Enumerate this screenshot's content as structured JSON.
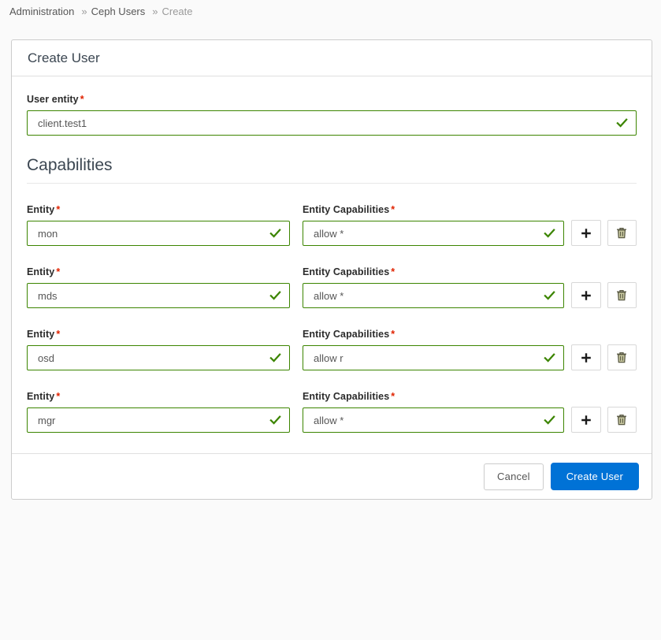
{
  "breadcrumb": {
    "items": [
      {
        "label": "Administration",
        "current": false
      },
      {
        "label": "Ceph Users",
        "current": false
      },
      {
        "label": "Create",
        "current": true
      }
    ],
    "separator": "»"
  },
  "card": {
    "title": "Create User"
  },
  "user_entity": {
    "label": "User entity",
    "required_marker": "*",
    "value": "client.test1",
    "placeholder": "",
    "valid": true
  },
  "capabilities": {
    "heading": "Capabilities",
    "entity_label": "Entity",
    "entity_caps_label": "Entity Capabilities",
    "required_marker": "*",
    "add_button_name": "add",
    "delete_button_name": "delete",
    "rows": [
      {
        "entity": "mon",
        "caps": "allow *",
        "entity_valid": true,
        "caps_valid": true
      },
      {
        "entity": "mds",
        "caps": "allow *",
        "entity_valid": true,
        "caps_valid": true
      },
      {
        "entity": "osd",
        "caps": "allow r",
        "entity_valid": true,
        "caps_valid": true
      },
      {
        "entity": "mgr",
        "caps": "allow *",
        "entity_valid": true,
        "caps_valid": true
      }
    ]
  },
  "footer": {
    "cancel_label": "Cancel",
    "submit_label": "Create User"
  },
  "colors": {
    "primary": "#0072d6",
    "valid_border": "#3c8500",
    "valid_check": "#3c8500",
    "required_asterisk": "#e02200",
    "title_text": "#3b4651",
    "label_text": "#2b2b2b",
    "input_text": "#565656",
    "card_border": "#cccccc",
    "page_background": "#fafafa"
  }
}
